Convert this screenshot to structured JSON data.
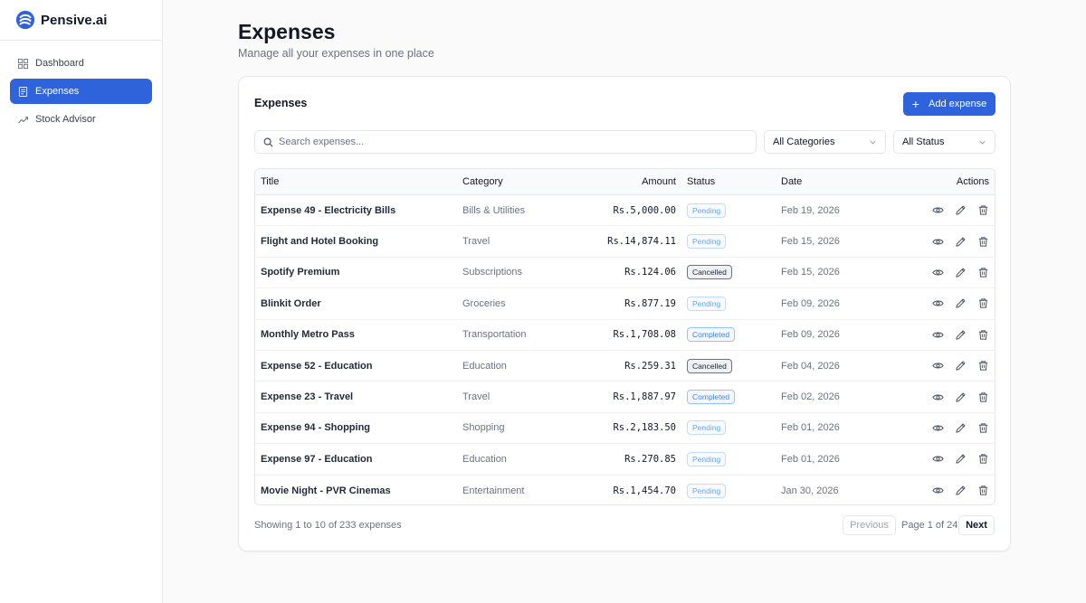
{
  "brand": {
    "name": "Pensive.ai"
  },
  "sidebar": {
    "items": [
      {
        "label": "Dashboard",
        "icon": "grid-icon"
      },
      {
        "label": "Expenses",
        "icon": "receipt-icon"
      },
      {
        "label": "Stock Advisor",
        "icon": "trending-up-icon"
      }
    ],
    "active": "Expenses"
  },
  "page": {
    "title": "Expenses",
    "subtitle": "Manage all your expenses in one place"
  },
  "card": {
    "title": "Expenses",
    "add_label": "Add expense"
  },
  "filters": {
    "search_placeholder": "Search expenses...",
    "category_value": "All Categories",
    "status_value": "All Status"
  },
  "table": {
    "headers": {
      "title": "Title",
      "category": "Category",
      "amount": "Amount",
      "status": "Status",
      "date": "Date",
      "actions": "Actions"
    },
    "rows": [
      {
        "title": "Expense 49 - Electricity Bills",
        "category": "Bills & Utilities",
        "amount": "Rs.5,000.00",
        "status": "Pending",
        "date": "Feb 19, 2026"
      },
      {
        "title": "Flight and Hotel Booking",
        "category": "Travel",
        "amount": "Rs.14,874.11",
        "status": "Pending",
        "date": "Feb 15, 2026"
      },
      {
        "title": "Spotify Premium",
        "category": "Subscriptions",
        "amount": "Rs.124.06",
        "status": "Cancelled",
        "date": "Feb 15, 2026"
      },
      {
        "title": "Blinkit Order",
        "category": "Groceries",
        "amount": "Rs.877.19",
        "status": "Pending",
        "date": "Feb 09, 2026"
      },
      {
        "title": "Monthly Metro Pass",
        "category": "Transportation",
        "amount": "Rs.1,708.08",
        "status": "Completed",
        "date": "Feb 09, 2026"
      },
      {
        "title": "Expense 52 - Education",
        "category": "Education",
        "amount": "Rs.259.31",
        "status": "Cancelled",
        "date": "Feb 04, 2026"
      },
      {
        "title": "Expense 23 - Travel",
        "category": "Travel",
        "amount": "Rs.1,887.97",
        "status": "Completed",
        "date": "Feb 02, 2026"
      },
      {
        "title": "Expense 94 - Shopping",
        "category": "Shopping",
        "amount": "Rs.2,183.50",
        "status": "Pending",
        "date": "Feb 01, 2026"
      },
      {
        "title": "Expense 97 - Education",
        "category": "Education",
        "amount": "Rs.270.85",
        "status": "Pending",
        "date": "Feb 01, 2026"
      },
      {
        "title": "Movie Night - PVR Cinemas",
        "category": "Entertainment",
        "amount": "Rs.1,454.70",
        "status": "Pending",
        "date": "Jan 30, 2026"
      }
    ]
  },
  "pagination": {
    "showing": "Showing 1 to 10 of 233 expenses",
    "previous": "Previous",
    "page_info": "Page 1 of 24",
    "next": "Next"
  },
  "colors": {
    "accent": "#2f63db",
    "pending": "#60a5fa",
    "completed": "#3b82f6",
    "cancelled": "#1f2937"
  }
}
